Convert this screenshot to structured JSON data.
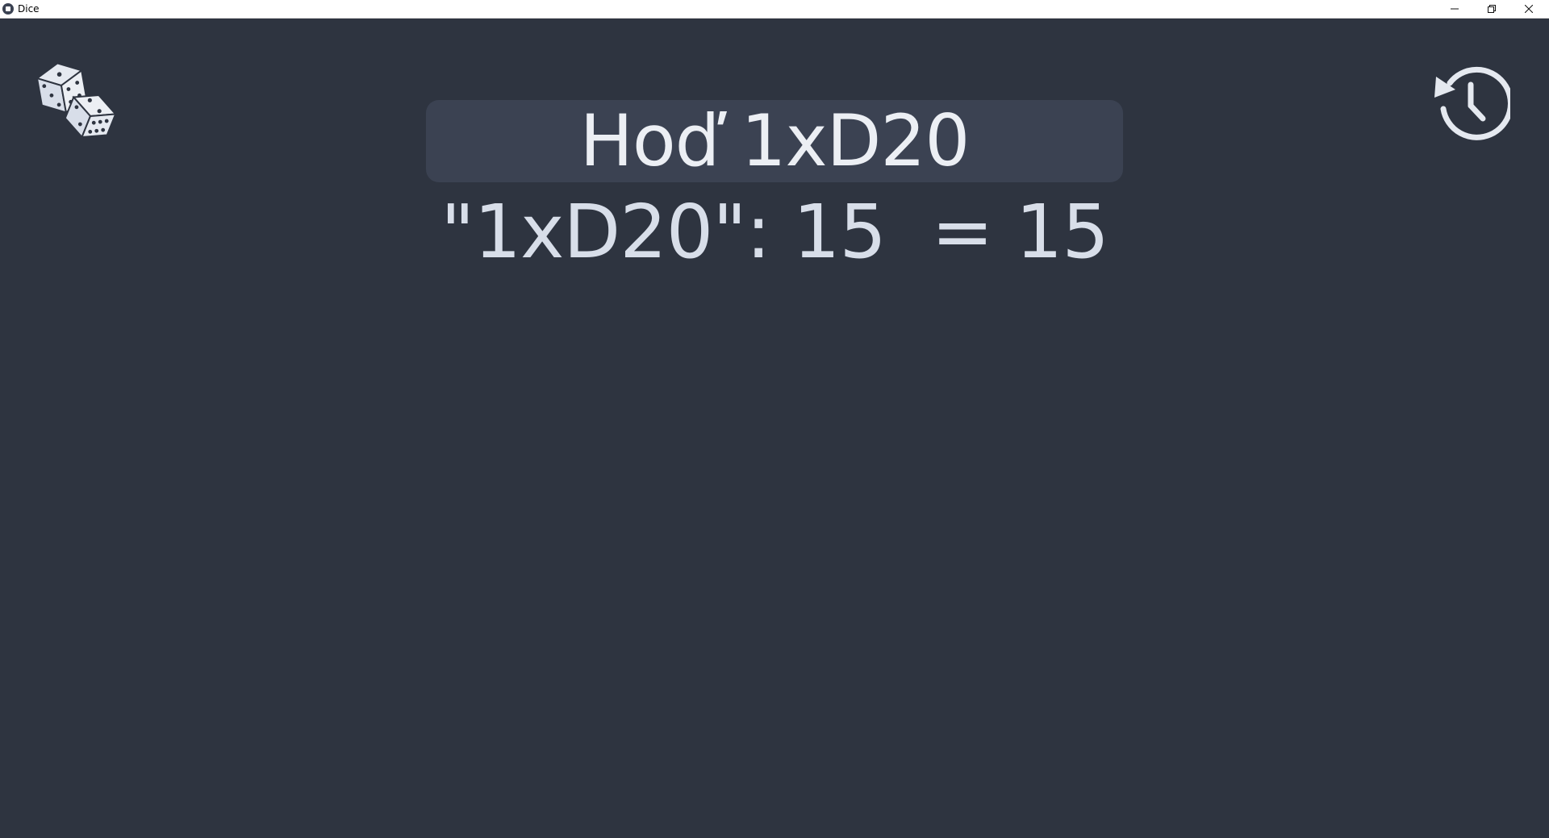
{
  "window": {
    "title": "Dice",
    "minimize_icon": "minimize-icon",
    "maximize_icon": "restore-icon",
    "close_icon": "close-icon"
  },
  "toolbar": {
    "dice_icon": "dice-icon",
    "history_icon": "history-icon"
  },
  "roll": {
    "title": "Hoď 1xD20",
    "result": "\"1xD20\": 15  = 15"
  },
  "colors": {
    "background": "#2e3440",
    "header_background": "#3b4252",
    "text": "#eceff4",
    "icon": "#d8dee9"
  }
}
